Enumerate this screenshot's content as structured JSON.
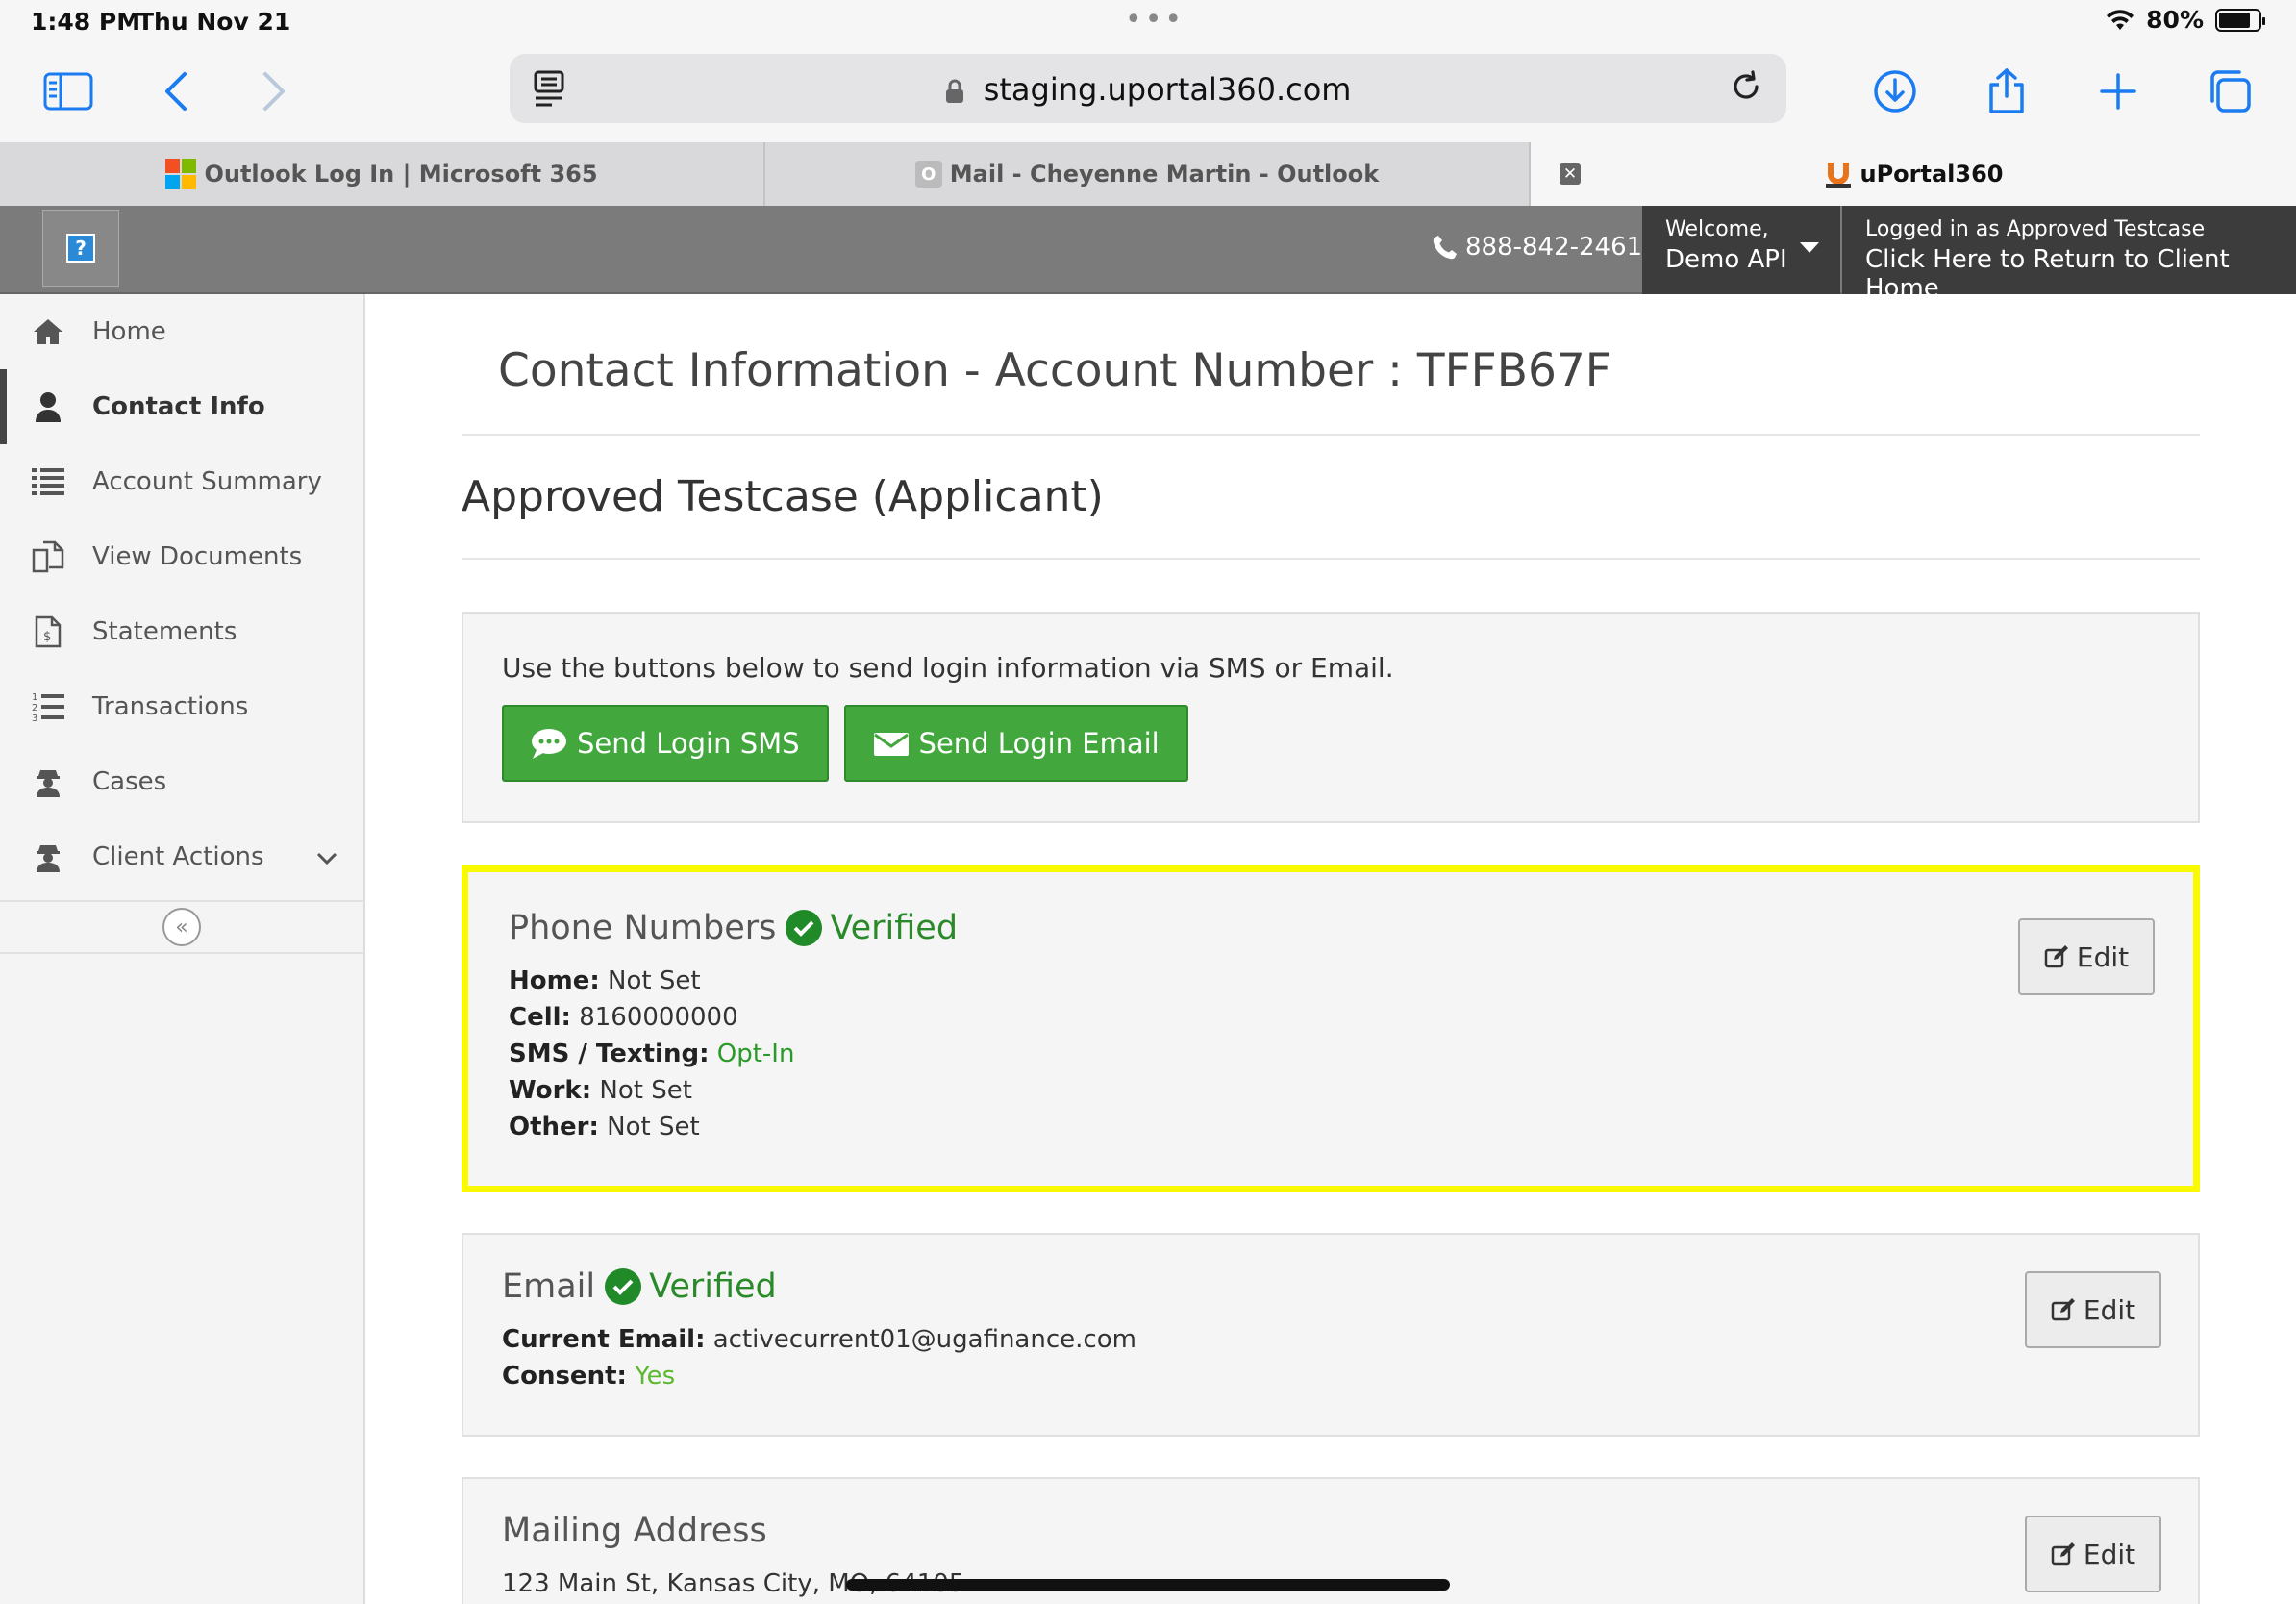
{
  "status_bar": {
    "time": "1:48 PM",
    "date": "Thu Nov 21",
    "battery": "80%",
    "battery_level": 0.8
  },
  "browser": {
    "url": "staging.uportal360.com",
    "tabs": [
      {
        "label": "Outlook Log In | Microsoft 365"
      },
      {
        "label": "Mail - Cheyenne Martin - Outlook",
        "favicon_letter": "O"
      },
      {
        "label": "uPortal360"
      }
    ]
  },
  "header": {
    "help": "?",
    "phone": "888-842-2461",
    "welcome_line1": "Welcome,",
    "welcome_line2": "Demo API",
    "logged_line1": "Logged in as Approved Testcase",
    "logged_line2": "Click Here to Return to Client Home"
  },
  "sidebar": {
    "items": [
      {
        "label": "Home",
        "icon": "home-icon"
      },
      {
        "label": "Contact Info",
        "icon": "user-icon",
        "active": true
      },
      {
        "label": "Account Summary",
        "icon": "list-icon"
      },
      {
        "label": "View Documents",
        "icon": "documents-icon"
      },
      {
        "label": "Statements",
        "icon": "statement-icon"
      },
      {
        "label": "Transactions",
        "icon": "ordered-list-icon"
      },
      {
        "label": "Cases",
        "icon": "agent-icon"
      },
      {
        "label": "Client Actions",
        "icon": "agent-icon"
      }
    ],
    "collapse": "«"
  },
  "main": {
    "title": "Contact Information - Account Number : TFFB67F",
    "applicant": "Approved Testcase (Applicant)",
    "login": {
      "message": "Use the buttons below to send login information via SMS or Email.",
      "sms_button": "Send Login SMS",
      "email_button": "Send Login Email"
    },
    "phones": {
      "title": "Phone Numbers",
      "verified": "Verified",
      "edit": "Edit",
      "home_label": "Home:",
      "home_value": "Not Set",
      "cell_label": "Cell:",
      "cell_value": "8160000000",
      "sms_label": "SMS / Texting:",
      "sms_value": "Opt-In",
      "work_label": "Work:",
      "work_value": "Not Set",
      "other_label": "Other:",
      "other_value": "Not Set"
    },
    "email": {
      "title": "Email",
      "verified": "Verified",
      "edit": "Edit",
      "current_label": "Current Email:",
      "current_value": "activecurrent01@ugafinance.com",
      "consent_label": "Consent:",
      "consent_value": "Yes"
    },
    "mailing": {
      "title": "Mailing Address",
      "edit": "Edit",
      "address": "123 Main St, Kansas City, MO, 64105"
    }
  },
  "colors": {
    "accent": "#1a7cf0",
    "success": "#42a83e",
    "highlight": "#f9f900",
    "header": "#7b7b7b"
  }
}
